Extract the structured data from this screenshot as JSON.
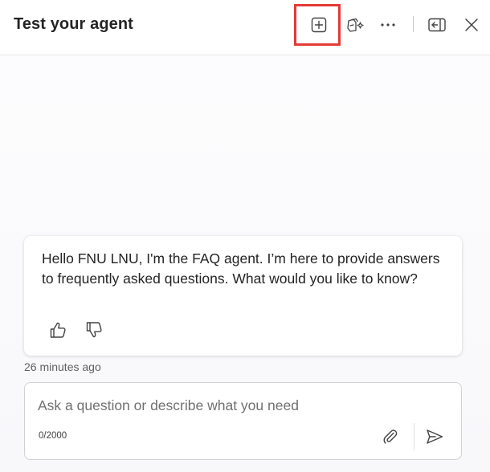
{
  "header": {
    "title": "Test your agent",
    "icons": [
      "new-chat-icon",
      "copilot-customize-icon",
      "more-icon",
      "dock-panel-icon",
      "close-icon"
    ]
  },
  "conversation": {
    "message": "Hello FNU LNU, I'm the FAQ agent. I’m here to provide answers to frequently asked questions. What would you like to know?",
    "timestamp": "26 minutes ago",
    "feedback_icons": [
      "thumbs-up-icon",
      "thumbs-down-icon"
    ]
  },
  "composer": {
    "placeholder": "Ask a question or describe what you need",
    "value": "",
    "char_count": "0/2000",
    "icons": [
      "attach-icon",
      "send-icon"
    ]
  },
  "colors": {
    "highlight": "#e43a36",
    "text": "#242424",
    "muted": "#616161"
  }
}
